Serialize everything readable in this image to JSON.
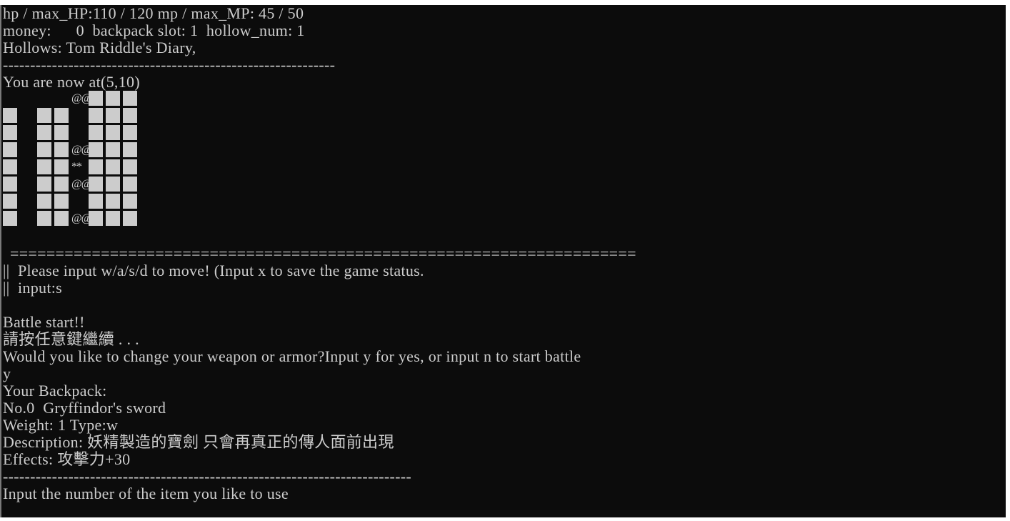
{
  "window": {
    "colors": {
      "background": "#0c0c0c",
      "text": "#cccccc",
      "frame": "#ffffff"
    }
  },
  "status": {
    "hp_line": "hp / max_HP:110 / 120 mp / max_MP: 45 / 50",
    "money_line": "money:      0  backpack slot: 1  hollow_num: 1",
    "hollows_line": "Hollows: Tom Riddle's Diary,",
    "divider": "-------------------------------------------------------------"
  },
  "location": {
    "text": "You are now at(5,10)"
  },
  "map": {
    "legend": {
      "wall": "block",
      "player": "@@",
      "enemy": "**"
    },
    "rows": [
      "....@WWW",
      "W.WW.WWW",
      "W.WW.WWW",
      "W.WW@WWW",
      "W.WW*WWW",
      "W.WW@WWW",
      "W.WW.WWW",
      "W.WW@WWW"
    ],
    "glyphs": {
      "@": "@@",
      "*": "**"
    }
  },
  "prompt": {
    "border_top": "=====================================================================",
    "move_line": "||  Please input w/a/s/d to move! (Input x to save the game status.",
    "input_line": "||  input:s"
  },
  "battle": {
    "start": "Battle start!!",
    "press_any_key": "請按任意鍵繼續 . . .",
    "change_question": "Would you like to change your weapon or armor?Input y for yes, or input n to start battle",
    "answer": "y"
  },
  "backpack": {
    "title": "Your Backpack:",
    "items": [
      {
        "header": "No.0  Gryffindor's sword",
        "weight_type": "Weight: 1 Type:w",
        "description": "Description: 妖精製造的寶劍 只會再真正的傳人面前出現",
        "effects": "Effects: 攻擊力+30"
      }
    ],
    "divider": "---------------------------------------------------------------------------",
    "use_prompt": "Input the number of the item you like to use"
  }
}
